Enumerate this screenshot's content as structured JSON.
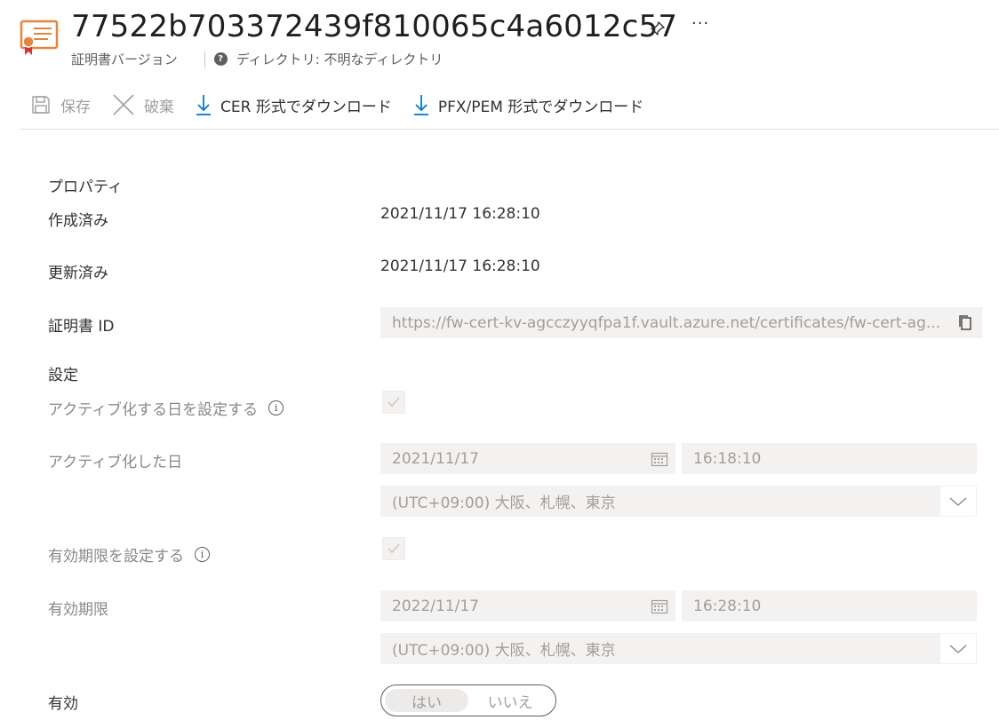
{
  "header": {
    "title": "77522b703372439f810065c4a6012c57",
    "subtitle": "証明書バージョン",
    "directory": "ディレクトリ: 不明なディレクトリ",
    "more": "···"
  },
  "toolbar": {
    "save": "保存",
    "discard": "破棄",
    "download_cer": "CER 形式でダウンロード",
    "download_pfx": "PFX/PEM 形式でダウンロード"
  },
  "properties": {
    "section": "プロパティ",
    "created_label": "作成済み",
    "created_value": "2021/11/17 16:28:10",
    "updated_label": "更新済み",
    "updated_value": "2021/11/17 16:28:10",
    "cert_id_label": "証明書 ID",
    "cert_id_value": "https://fw-cert-kv-agcczyyqfpa1f.vault.azure.net/certificates/fw-cert-ag..."
  },
  "settings": {
    "section": "設定",
    "set_activation_label": "アクティブ化する日を設定する",
    "set_activation_checked": true,
    "activation_label": "アクティブ化した日",
    "activation_date": "2021/11/17",
    "activation_time": "16:18:10",
    "activation_tz": "(UTC+09:00) 大阪、札幌、東京",
    "set_expiry_label": "有効期限を設定する",
    "set_expiry_checked": true,
    "expiry_label": "有効期限",
    "expiry_date": "2022/11/17",
    "expiry_time": "16:28:10",
    "expiry_tz": "(UTC+09:00) 大阪、札幌、東京",
    "enabled_label": "有効",
    "enabled_yes": "はい",
    "enabled_no": "いいえ",
    "enabled_selected": "はい"
  },
  "colors": {
    "accent": "#0078d4",
    "cert_orange": "#e8833a",
    "cert_ribbon": "#d13438"
  }
}
